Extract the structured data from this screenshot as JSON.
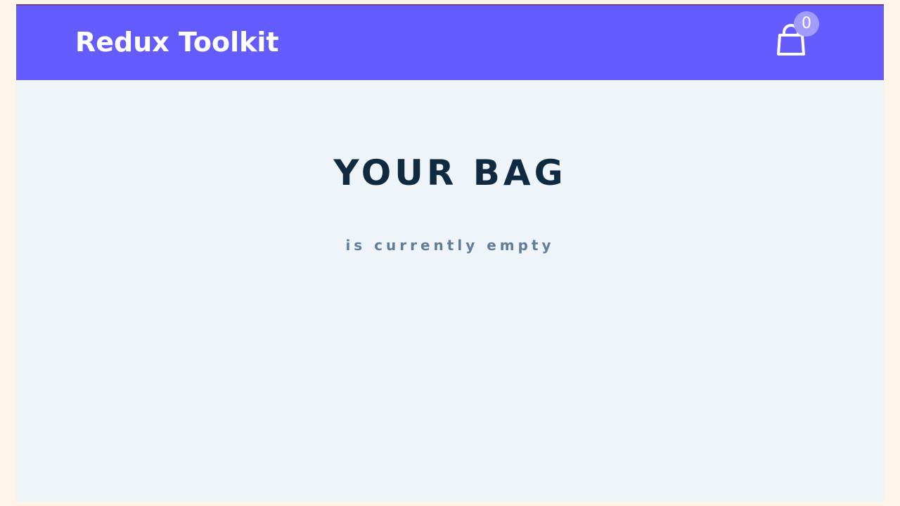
{
  "navbar": {
    "brand": "Redux Toolkit",
    "cart_icon": "shopping-bag-icon",
    "cart_count": "0",
    "background_color": "#645cff",
    "badge_color": "#a29cff"
  },
  "main": {
    "title": "YOUR BAG",
    "subtitle": "is currently empty",
    "background_color": "#eef4f7"
  }
}
